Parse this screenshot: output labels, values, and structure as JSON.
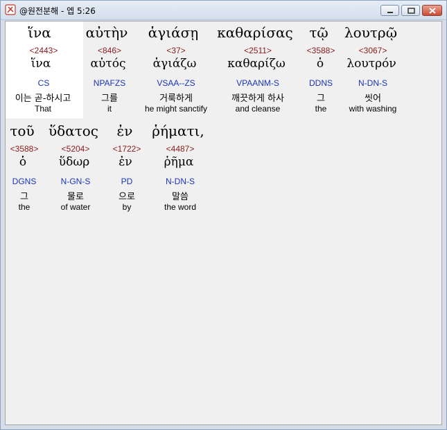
{
  "window": {
    "title": "@원전분해 - 엡 5:26",
    "icon": "compass-icon",
    "buttons": [
      "minimize-icon",
      "maximize-icon",
      "close-icon"
    ]
  },
  "rows": [
    {
      "words": [
        {
          "greek": "ἵνα",
          "strong": "<2443>",
          "lemma": "ἵνα",
          "morph": "CS",
          "korean": "이는 곧-하시고",
          "english": "That"
        },
        {
          "greek": "αὐτὴν",
          "strong": "<846>",
          "lemma": "αὐτός",
          "morph": "NPAFZS",
          "korean": "그를",
          "english": "it"
        },
        {
          "greek": "ἁγιάσῃ",
          "strong": "<37>",
          "lemma": "ἁγιάζω",
          "morph": "VSAA--ZS",
          "korean": "거룩하게",
          "english": "he might sanctify"
        },
        {
          "greek": "καθαρίσας",
          "strong": "<2511>",
          "lemma": "καθαρίζω",
          "morph": "VPAANM-S",
          "korean": "깨끗하게 하사",
          "english": "and cleanse"
        },
        {
          "greek": "τῷ",
          "strong": "<3588>",
          "lemma": "ὁ",
          "morph": "DDNS",
          "korean": "그",
          "english": "the"
        },
        {
          "greek": "λουτρῷ",
          "strong": "<3067>",
          "lemma": "λουτρόν",
          "morph": "N-DN-S",
          "korean": "씻어",
          "english": "with washing"
        }
      ]
    },
    {
      "words": [
        {
          "greek": "τοῦ",
          "strong": "<3588>",
          "lemma": "ὁ",
          "morph": "DGNS",
          "korean": "그",
          "english": "the"
        },
        {
          "greek": "ὕδατος",
          "strong": "<5204>",
          "lemma": "ὕδωρ",
          "morph": "N-GN-S",
          "korean": "물로",
          "english": "of water"
        },
        {
          "greek": "ἐν",
          "strong": "<1722>",
          "lemma": "ἐν",
          "morph": "PD",
          "korean": "으로",
          "english": "by"
        },
        {
          "greek": "ῥήματι,",
          "strong": "<4487>",
          "lemma": "ῥῆμα",
          "morph": "N-DN-S",
          "korean": "말씀",
          "english": "the word"
        }
      ]
    }
  ]
}
